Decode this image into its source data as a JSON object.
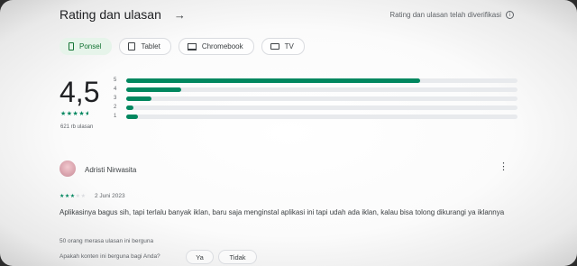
{
  "header": {
    "title": "Rating dan ulasan",
    "arrow_icon": "arrow-right-icon",
    "verified_text": "Rating dan ulasan telah diverifikasi",
    "info_icon": "info-icon"
  },
  "devices": [
    {
      "label": "Ponsel",
      "icon": "phone-icon",
      "active": true
    },
    {
      "label": "Tablet",
      "icon": "tablet-icon",
      "active": false
    },
    {
      "label": "Chromebook",
      "icon": "laptop-icon",
      "active": false
    },
    {
      "label": "TV",
      "icon": "tv-icon",
      "active": false
    }
  ],
  "summary": {
    "rating": "4,5",
    "stars": 4.5,
    "review_count": "621 rb ulasan"
  },
  "distribution": [
    {
      "label": "5",
      "fraction": 0.75
    },
    {
      "label": "4",
      "fraction": 0.14
    },
    {
      "label": "3",
      "fraction": 0.065
    },
    {
      "label": "2",
      "fraction": 0.018
    },
    {
      "label": "1",
      "fraction": 0.03
    }
  ],
  "review": {
    "reviewer": "Adristi Nirwasita",
    "stars": 3,
    "date": "2 Juni 2023",
    "text": "Aplikasinya bagus sih, tapi terlalu banyak iklan, baru saja menginstal aplikasi ini tapi udah ada iklan, kalau bisa tolong dikurangi ya iklannya",
    "helpful_count": "50 orang merasa ulasan ini berguna",
    "question": "Apakah konten ini berguna bagi Anda?",
    "yes_label": "Ya",
    "no_label": "Tidak"
  },
  "colors": {
    "accent": "#01875f",
    "chip_active_bg": "#e6f4ea",
    "chip_active_text": "#137333"
  }
}
